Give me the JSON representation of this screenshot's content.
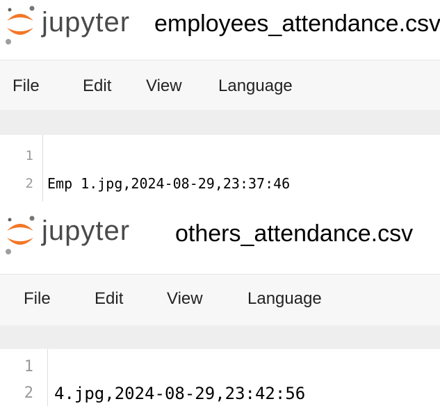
{
  "panels": [
    {
      "brand": "jupyter",
      "filename": "employees_attendance.csv",
      "menu": [
        "File",
        "Edit",
        "View",
        "Language"
      ],
      "lines": [
        {
          "num": "1",
          "text": ""
        },
        {
          "num": "2",
          "text": "Emp 1.jpg,2024-08-29,23:37:46"
        }
      ]
    },
    {
      "brand": "jupyter",
      "filename": "others_attendance.csv",
      "menu": [
        "File",
        "Edit",
        "View",
        "Language"
      ],
      "lines": [
        {
          "num": "1",
          "text": ""
        },
        {
          "num": "2",
          "text": "4.jpg,2024-08-29,23:42:56"
        }
      ]
    }
  ],
  "colors": {
    "jupyter_orange": "#F37726",
    "menubar_bg": "#f7f7f7",
    "toolbar_bg": "#eeeeee",
    "line_number": "#999999"
  },
  "icons": {
    "logo": "jupyter-logo-icon"
  }
}
